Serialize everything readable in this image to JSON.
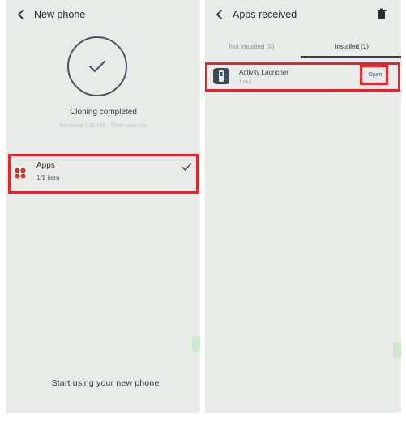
{
  "left_screen": {
    "header": {
      "title": "New phone"
    },
    "status": {
      "title": "Cloning completed",
      "subtitle": "Received 1.30 MB · Time used 20s"
    },
    "apps_row": {
      "title": "Apps",
      "count": "1/1 item"
    },
    "start_button": {
      "label": "Start using your new phone"
    }
  },
  "right_screen": {
    "header": {
      "title": "Apps received"
    },
    "tabs": [
      {
        "label": "Not installed (0)",
        "selected": false
      },
      {
        "label": "Installed (1)",
        "selected": true
      }
    ],
    "app_row": {
      "name": "Activity Launcher",
      "version": "1.14.6",
      "action_label": "Open"
    }
  },
  "colors": {
    "screen_background": "#e9ebe9",
    "highlight": "#e3242b",
    "accent_check": "#4a5561",
    "apps_icon": "#c0392b",
    "open_text": "#4c6a8c"
  },
  "icons": {
    "back": "chevron-left-icon",
    "trash": "trash-icon",
    "check": "check-icon",
    "apps": "apps-cluster-icon",
    "app": "activity-launcher-app-icon"
  }
}
